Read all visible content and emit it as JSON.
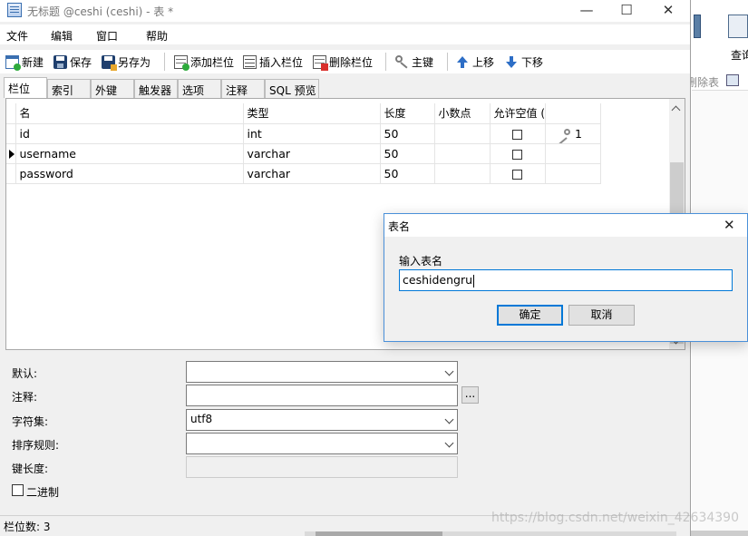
{
  "window": {
    "title": "无标题 @ceshi (ceshi) - 表 *",
    "controls": {
      "minimize": "—",
      "maximize": "☐",
      "close": "✕"
    }
  },
  "menu": [
    "文件",
    "编辑",
    "窗口",
    "帮助"
  ],
  "toolbar": {
    "new": "新建",
    "save": "保存",
    "save_as": "另存为",
    "add_field": "添加栏位",
    "insert_field": "插入栏位",
    "delete_field": "删除栏位",
    "primary_key": "主键",
    "move_up": "上移",
    "move_down": "下移"
  },
  "tabs": [
    "栏位",
    "索引",
    "外键",
    "触发器",
    "选项",
    "注释",
    "SQL 预览"
  ],
  "active_tab": "栏位",
  "grid": {
    "columns": [
      "名",
      "类型",
      "长度",
      "小数点",
      "允许空值 ("
    ],
    "rows": [
      {
        "name": "id",
        "type": "int",
        "length": "50",
        "decimals": "",
        "nullable": false,
        "key": "1",
        "current": false
      },
      {
        "name": "username",
        "type": "varchar",
        "length": "50",
        "decimals": "",
        "nullable": false,
        "key": "",
        "current": true
      },
      {
        "name": "password",
        "type": "varchar",
        "length": "50",
        "decimals": "",
        "nullable": false,
        "key": "",
        "current": false
      }
    ]
  },
  "properties": {
    "default_label": "默认:",
    "comment_label": "注释:",
    "comment_button": "...",
    "charset_label": "字符集:",
    "charset_value": "utf8",
    "collation_label": "排序规则:",
    "key_length_label": "键长度:",
    "binary_label": "二进制"
  },
  "status": {
    "field_count": "栏位数: 3"
  },
  "background_window": {
    "query_label": "查询",
    "delete_table_label": "删除表"
  },
  "dialog": {
    "title": "表名",
    "prompt": "输入表名",
    "value": "ceshidengru",
    "ok": "确定",
    "cancel": "取消"
  },
  "watermark": "https://blog.csdn.net/weixin_42634390",
  "colors": {
    "accent": "#0078d7",
    "dialog_border": "#4a90d9"
  }
}
